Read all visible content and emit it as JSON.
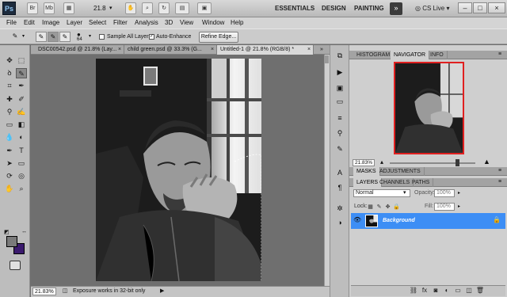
{
  "app": {
    "logo": "Ps",
    "br_label": "Br",
    "mb_label": "Mb",
    "zoom_select": "21.8",
    "workspaces": [
      "ESSENTIALS",
      "DESIGN",
      "PAINTING"
    ],
    "more_label": "»",
    "cslive": "CS Live",
    "window_buttons": [
      "–",
      "□",
      "×"
    ]
  },
  "menus": [
    "File",
    "Edit",
    "Image",
    "Layer",
    "Select",
    "Filter",
    "Analysis",
    "3D",
    "View",
    "Window",
    "Help"
  ],
  "options": {
    "brush_size": "64",
    "sample_all_layers": "Sample All Layers",
    "auto_enhance": "Auto-Enhance",
    "refine_edge": "Refine Edge..."
  },
  "tabs": [
    {
      "label": "DSC00542.psd @ 21.8% (Lay...",
      "active": false
    },
    {
      "label": "child green.psd @ 33.3% (G...",
      "active": false
    },
    {
      "label": "Untitled-1 @ 21.8% (RGB/8) *",
      "active": true
    }
  ],
  "status": {
    "zoom": "21.83%",
    "message": "Exposure works in 32-bit only",
    "arrow": "▶"
  },
  "navigator": {
    "tabs": [
      "HISTOGRAM",
      "NAVIGATOR",
      "INFO"
    ],
    "active_tab": "NAVIGATOR",
    "zoom": "21.83%"
  },
  "masks": {
    "tabs": [
      "MASKS",
      "ADJUSTMENTS"
    ]
  },
  "layers": {
    "tabs": [
      "LAYERS",
      "CHANNELS",
      "PATHS"
    ],
    "blend_mode": "Normal",
    "opacity_label": "Opacity:",
    "opacity_value": "100%",
    "lock_label": "Lock:",
    "fill_label": "Fill:",
    "fill_value": "100%",
    "layer_name": "Background"
  },
  "colors": {
    "foreground": "#7a7a7a",
    "background": "#3b1a6e",
    "selection": "#3d8ef5",
    "nav_frame": "#e02020"
  }
}
